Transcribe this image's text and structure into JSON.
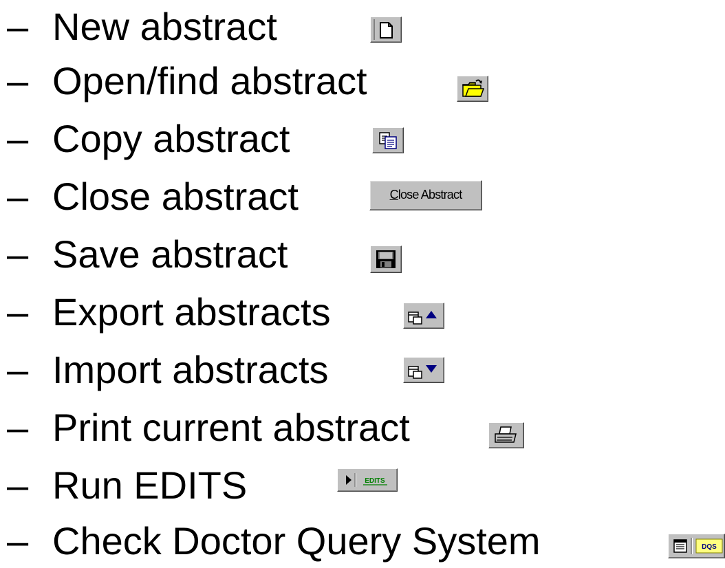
{
  "items": [
    {
      "dash": "–",
      "label": "New abstract",
      "icon": "new-document-icon"
    },
    {
      "dash": "–",
      "label": "Open/find abstract",
      "icon": "open-folder-icon"
    },
    {
      "dash": "–",
      "label": "Copy abstract",
      "icon": "copy-icon"
    },
    {
      "dash": "–",
      "label": "Close abstract",
      "icon": "close-abstract-button"
    },
    {
      "dash": "–",
      "label": "Save abstract",
      "icon": "floppy-disk-icon"
    },
    {
      "dash": "–",
      "label": "Export abstracts",
      "icon": "export-icon"
    },
    {
      "dash": "–",
      "label": "Import abstracts",
      "icon": "import-icon"
    },
    {
      "dash": "–",
      "label": "Print current abstract",
      "icon": "printer-icon"
    },
    {
      "dash": "–",
      "label": "Run EDITS",
      "icon": "run-edits-icon"
    },
    {
      "dash": "–",
      "label": "Check Doctor Query System",
      "icon": "dqs-icon"
    }
  ],
  "buttons": {
    "close_abstract": {
      "underlined": "C",
      "rest": "lose Abstract"
    },
    "edits_label": "EDITS",
    "dqs_label": "DQS"
  },
  "colors": {
    "button_face": "#c0c0c0",
    "text": "#000000",
    "folder_yellow": "#ffff00",
    "edits_green": "#008000"
  }
}
